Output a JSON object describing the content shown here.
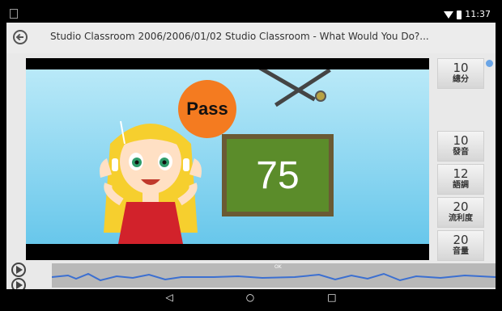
{
  "statusbar": {
    "time": "11:37"
  },
  "header": {
    "title": "Studio Classroom 2006/2006/01/02 Studio Classroom - What Would You Do?..."
  },
  "video": {
    "pass_label": "Pass",
    "score": "75"
  },
  "scores": [
    {
      "value": "10",
      "label": "總分"
    },
    {
      "value": "10",
      "label": "發音"
    },
    {
      "value": "12",
      "label": "語調"
    },
    {
      "value": "20",
      "label": "流利度"
    },
    {
      "value": "20",
      "label": "音量"
    }
  ],
  "timeline": {
    "ok_label": "OK"
  },
  "nav": {
    "back": "◁",
    "home": "○",
    "recents": "□"
  },
  "colors": {
    "pass_bubble": "#f47b20",
    "board": "#5b8c2a",
    "accent": "#6aa5e6"
  }
}
